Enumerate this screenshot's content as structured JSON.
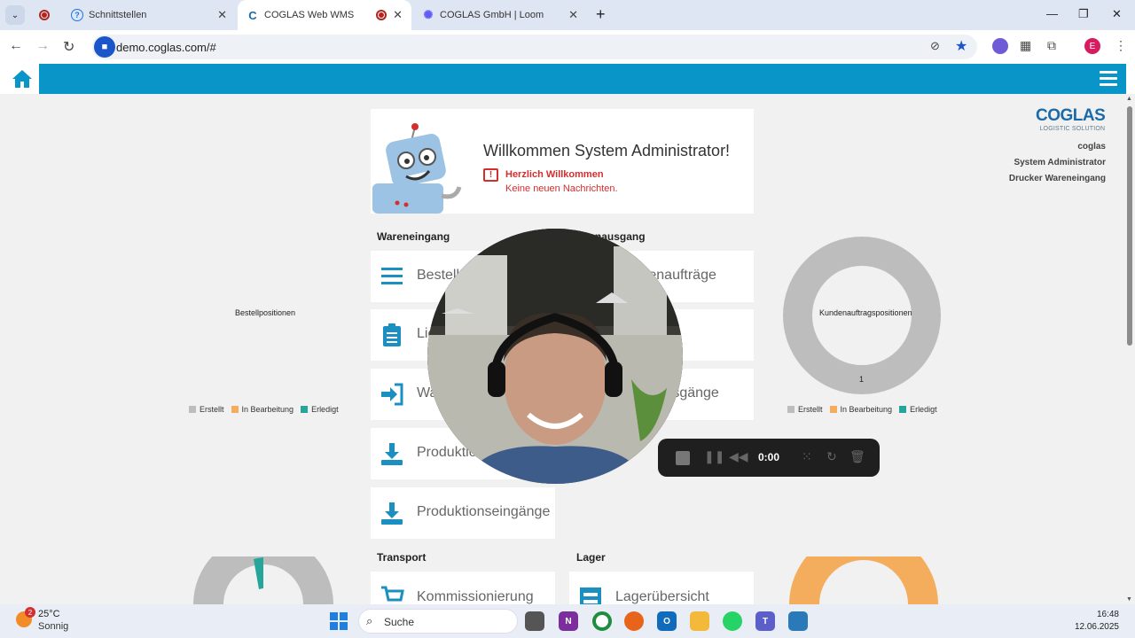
{
  "browser": {
    "tabs": [
      {
        "label": "",
        "icon": "recording-icon"
      },
      {
        "label": "Schnittstellen",
        "icon": "help-circle-icon"
      },
      {
        "label": "COGLAS Web WMS",
        "icon": "coglas-c-icon",
        "active": true
      },
      {
        "label": "COGLAS GmbH | Loom",
        "icon": "loom-icon"
      }
    ],
    "url": "demo.coglas.com/#"
  },
  "welcome": {
    "title": "Willkommen System Administrator!",
    "message_title": "Herzlich Willkommen",
    "message_text": "Keine neuen Nachrichten."
  },
  "sections": {
    "wareneingang": "Wareneingang",
    "warenausgang": "Warenausgang",
    "transport": "Transport",
    "lager": "Lager"
  },
  "tiles": {
    "bestellungen": "Bestellungen",
    "lieferungen": "Lieferungen",
    "wareneingaenge": "Wareneingänge",
    "produktionsauftraege": "Produktionsaufträge",
    "produktionseingaenge": "Produktionseingänge",
    "kundenauftraege": "Kundenaufträge",
    "warenausgaenge": "Warenausgänge",
    "kommissionierung": "Kommissionierung",
    "lageruebersicht": "Lagerübersicht"
  },
  "logo": {
    "main": "COGLAS",
    "sub": "LOGISTIC SOLUTION"
  },
  "user": {
    "name": "coglas",
    "role": "System Administrator",
    "printer": "Drucker Wareneingang"
  },
  "charts": {
    "left_title": "Bestellpositionen",
    "right_title": "Kundenauftragspositionen",
    "right_value_label": "1",
    "legend": [
      "Erstellt",
      "In Bearbeitung",
      "Erledigt"
    ],
    "colors": {
      "erstellt": "#bdbdbd",
      "in_bearbeitung": "#f4ad5c",
      "erledigt": "#26a69a"
    }
  },
  "chart_data": [
    {
      "type": "pie",
      "title": "Bestellpositionen",
      "categories": [
        "Erstellt",
        "In Bearbeitung",
        "Erledigt"
      ],
      "values": [
        0,
        0,
        0
      ],
      "legend": "bottom"
    },
    {
      "type": "pie",
      "title": "Kundenauftragspositionen",
      "categories": [
        "Erstellt",
        "In Bearbeitung",
        "Erledigt"
      ],
      "values": [
        1,
        0,
        0
      ],
      "legend": "bottom"
    }
  ],
  "loom": {
    "time": "0:00"
  },
  "taskbar": {
    "weather_temp": "25°C",
    "weather_desc": "Sonnig",
    "weather_badge": "2",
    "search_placeholder": "Suche",
    "time": "16:48",
    "date": "12.06.2025"
  }
}
